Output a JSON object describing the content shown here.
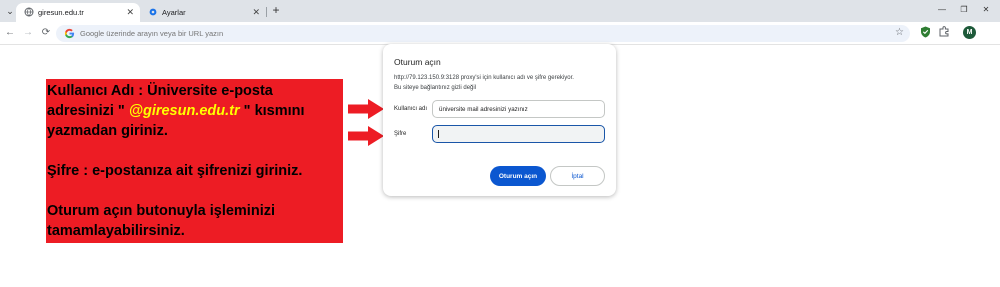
{
  "tabs": [
    {
      "title": "giresun.edu.tr",
      "close": "✕"
    },
    {
      "title": "Ayarlar",
      "close": "✕"
    }
  ],
  "new_tab": "+",
  "window_controls": {
    "minimize": "—",
    "maximize": "❐",
    "close": "✕"
  },
  "toolbar": {
    "back": "←",
    "forward": "→",
    "reload": "⟳",
    "omnibox_placeholder": "Google üzerinde arayın veya bir URL yazın",
    "avatar_initial": "M"
  },
  "info": {
    "line1": "Kullanıcı Adı : Üniversite e-posta",
    "line2_pre": "adresinizi \" ",
    "line2_domain": "@giresun.edu.tr",
    "line2_post": " \" kısmını",
    "line3": "yazmadan giriniz.",
    "line4": "Şifre : e-postanıza ait şifrenizi giriniz.",
    "line5": "Oturum açın butonuyla işleminizi",
    "line6": "tamamlayabilirsiniz.",
    "bg_color": "#ed1c24",
    "highlight_color": "#ffff00"
  },
  "dialog": {
    "title": "Oturum açın",
    "message1": "http://79.123.150.9:3128 proxy'si için kullanıcı adı ve şifre gerekiyor.",
    "message2": "Bu siteye bağlantınız gizli değil",
    "username_label": "Kullanıcı adı",
    "username_value": "üniversite mail adresinizi yazınız",
    "password_label": "Şifre",
    "password_value": "",
    "signin_button": "Oturum açın",
    "cancel_button": "İptal",
    "accent_color": "#0b57d0"
  }
}
